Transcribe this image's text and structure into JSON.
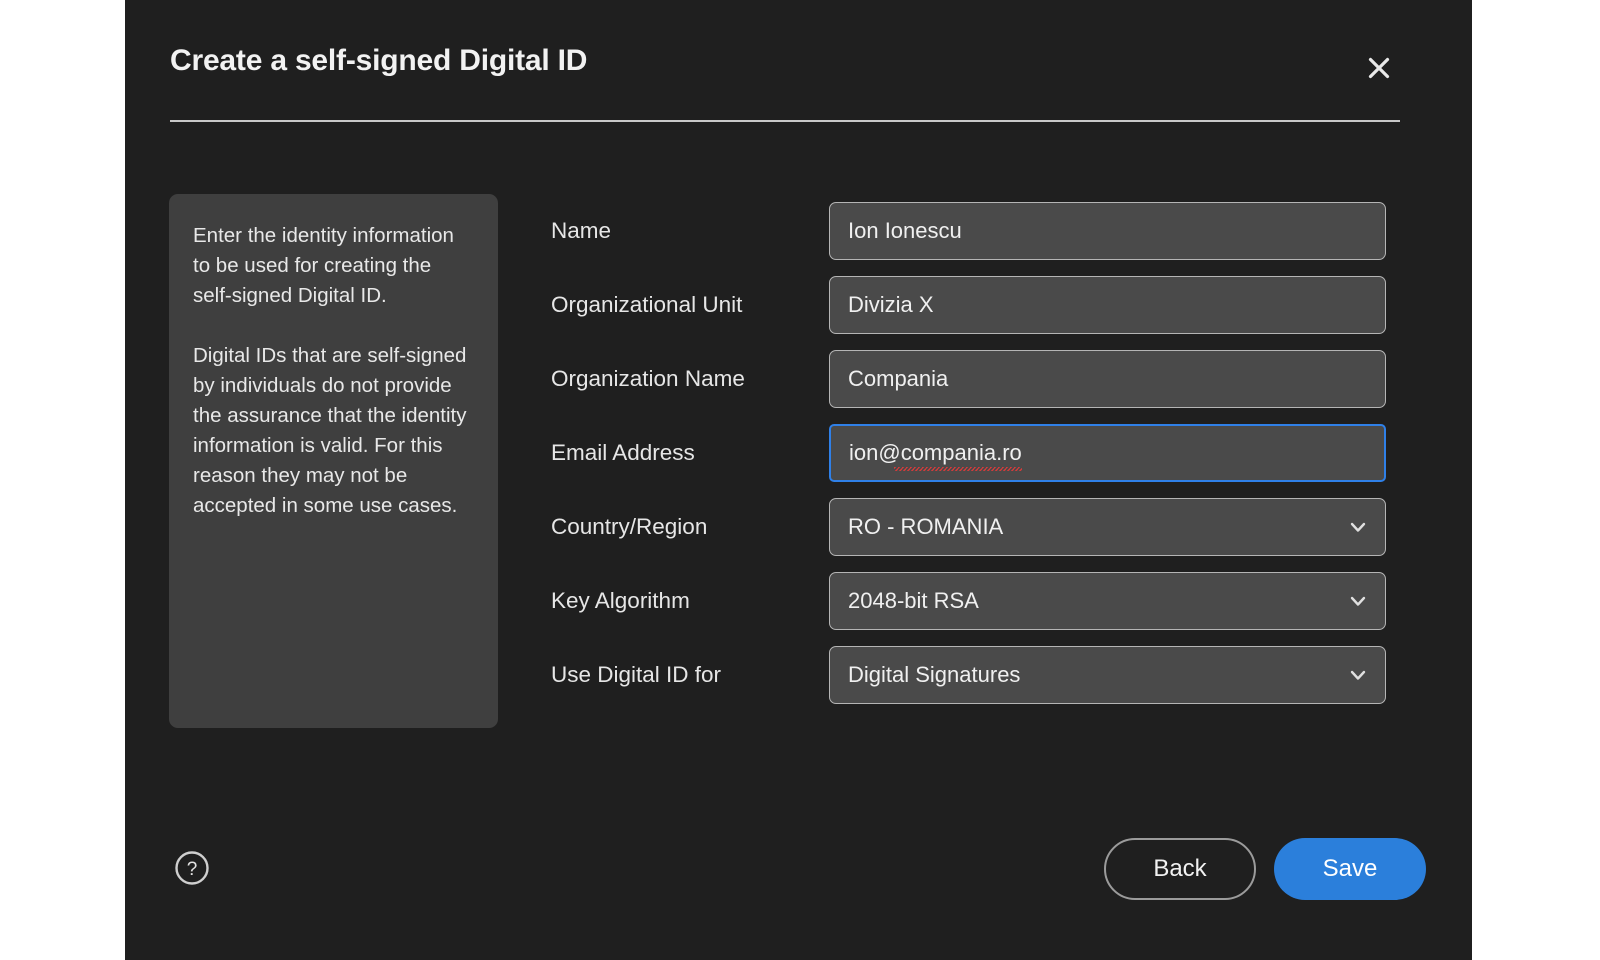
{
  "dialog": {
    "title": "Create a self-signed Digital ID",
    "close_icon": "close-icon"
  },
  "info_panel": {
    "paragraph_1": "Enter the identity information to be used for creating the self-signed Digital ID.",
    "paragraph_2": "Digital IDs that are self-signed by individuals do not provide the assurance that the identity information is valid. For this reason they may not be accepted in some use cases."
  },
  "form": {
    "fields": [
      {
        "label": "Name",
        "type": "text",
        "value": "Ion Ionescu",
        "placeholder": "",
        "focused": false,
        "spellerror": false,
        "name": "name"
      },
      {
        "label": "Organizational Unit",
        "type": "text",
        "value": "Divizia X",
        "placeholder": "",
        "focused": false,
        "spellerror": false,
        "name": "organizational-unit"
      },
      {
        "label": "Organization Name",
        "type": "text",
        "value": "Compania",
        "placeholder": "",
        "focused": false,
        "spellerror": false,
        "name": "organization-name"
      },
      {
        "label": "Email Address",
        "type": "text",
        "value": "ion@compania.ro",
        "placeholder": "",
        "focused": true,
        "spellerror": true,
        "name": "email-address"
      },
      {
        "label": "Country/Region",
        "type": "select",
        "value": "RO - ROMANIA",
        "placeholder": "",
        "focused": false,
        "spellerror": false,
        "name": "country-region"
      },
      {
        "label": "Key Algorithm",
        "type": "select",
        "value": "2048-bit RSA",
        "placeholder": "",
        "focused": false,
        "spellerror": false,
        "name": "key-algorithm"
      },
      {
        "label": "Use Digital ID for",
        "type": "select",
        "value": "Digital Signatures",
        "placeholder": "",
        "focused": false,
        "spellerror": false,
        "name": "use-digital-id-for"
      }
    ]
  },
  "footer": {
    "help_icon": "help-circle-icon",
    "back_label": "Back",
    "save_label": "Save"
  },
  "colors": {
    "dialog_background": "#1f1f1f",
    "page_background": "#ffffff",
    "info_panel_background": "#3f3f3f",
    "field_background": "#4a4a4a",
    "field_border": "#b5b5b5",
    "focus_border": "#2f80e8",
    "primary_button": "#2b7fdb",
    "text": "#f0f0f0",
    "spellcheck_underline": "#d23b3b"
  }
}
